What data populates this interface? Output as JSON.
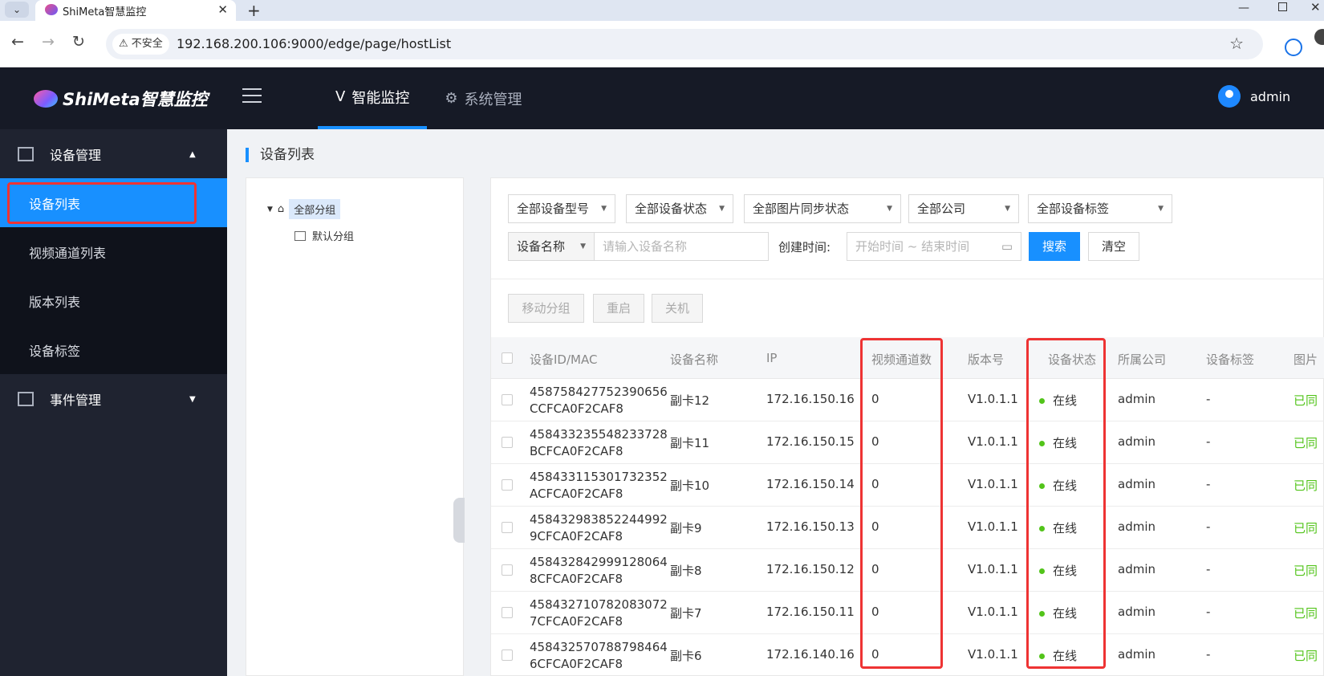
{
  "browser": {
    "tab_menu": "⌄",
    "tab_title": "ShiMeta智慧监控",
    "tab_close": "✕",
    "new_tab": "+",
    "insecure": "不安全",
    "url": "192.168.200.106:9000/edge/page/hostList"
  },
  "header": {
    "logo": "ShiMeta智慧监控",
    "nav": [
      {
        "icon": "ᐯ",
        "label": "智能监控"
      },
      {
        "icon": "⚙",
        "label": "系统管理"
      }
    ],
    "user": "admin"
  },
  "sidebar": {
    "group1": "设备管理",
    "items": [
      "设备列表",
      "视频通道列表",
      "版本列表",
      "设备标签"
    ],
    "group2": "事件管理"
  },
  "page": {
    "title": "设备列表"
  },
  "tree": {
    "root": "全部分组",
    "child": "默认分组"
  },
  "filters": {
    "model": "全部设备型号",
    "status": "全部设备状态",
    "sync": "全部图片同步状态",
    "company": "全部公司",
    "tag": "全部设备标签",
    "field": "设备名称",
    "name_placeholder": "请输入设备名称",
    "created_label": "创建时间:",
    "date_placeholder": "开始时间 ~ 结束时间",
    "search": "搜索",
    "clear": "清空"
  },
  "actions": {
    "move": "移动分组",
    "restart": "重启",
    "shutdown": "关机"
  },
  "table": {
    "columns": [
      "设备ID/MAC",
      "设备名称",
      "IP",
      "视频通道数",
      "版本号",
      "设备状态",
      "所属公司",
      "设备标签",
      "图片"
    ],
    "rows": [
      {
        "id": "458758427752390656",
        "mac": "CCFCA0F2CAF8",
        "name": "副卡12",
        "ip": "172.16.150.16",
        "channels": "0",
        "version": "V1.0.1.1",
        "status": "在线",
        "company": "admin",
        "tag": "-",
        "sync": "已同"
      },
      {
        "id": "458433235548233728",
        "mac": "BCFCA0F2CAF8",
        "name": "副卡11",
        "ip": "172.16.150.15",
        "channels": "0",
        "version": "V1.0.1.1",
        "status": "在线",
        "company": "admin",
        "tag": "-",
        "sync": "已同"
      },
      {
        "id": "458433115301732352",
        "mac": "ACFCA0F2CAF8",
        "name": "副卡10",
        "ip": "172.16.150.14",
        "channels": "0",
        "version": "V1.0.1.1",
        "status": "在线",
        "company": "admin",
        "tag": "-",
        "sync": "已同"
      },
      {
        "id": "458432983852244992",
        "mac": "9CFCA0F2CAF8",
        "name": "副卡9",
        "ip": "172.16.150.13",
        "channels": "0",
        "version": "V1.0.1.1",
        "status": "在线",
        "company": "admin",
        "tag": "-",
        "sync": "已同"
      },
      {
        "id": "458432842999128064",
        "mac": "8CFCA0F2CAF8",
        "name": "副卡8",
        "ip": "172.16.150.12",
        "channels": "0",
        "version": "V1.0.1.1",
        "status": "在线",
        "company": "admin",
        "tag": "-",
        "sync": "已同"
      },
      {
        "id": "458432710782083072",
        "mac": "7CFCA0F2CAF8",
        "name": "副卡7",
        "ip": "172.16.150.11",
        "channels": "0",
        "version": "V1.0.1.1",
        "status": "在线",
        "company": "admin",
        "tag": "-",
        "sync": "已同"
      },
      {
        "id": "458432570788798464",
        "mac": "6CFCA0F2CAF8",
        "name": "副卡6",
        "ip": "172.16.140.16",
        "channels": "0",
        "version": "V1.0.1.1",
        "status": "在线",
        "company": "admin",
        "tag": "-",
        "sync": "已同"
      }
    ]
  },
  "colors": {
    "accent": "#1890ff",
    "header_bg": "#161a26",
    "sidebar_bg": "#1f2330",
    "online": "#52c41a",
    "annotation": "#e33333"
  }
}
